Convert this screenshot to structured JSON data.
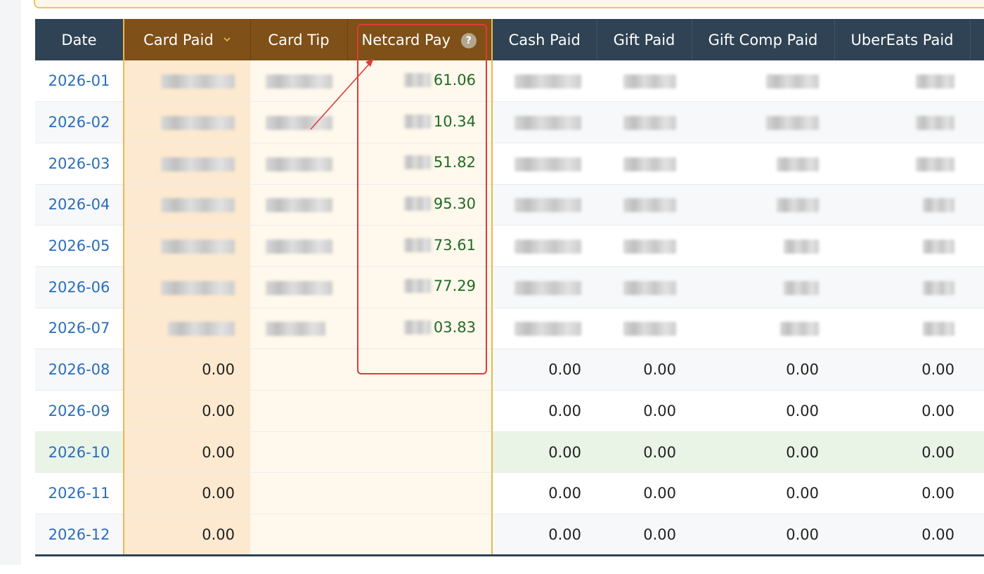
{
  "table": {
    "columns": {
      "date": "Date",
      "card_paid": "Card Paid",
      "card_tip": "Card Tip",
      "netcard_pay": "Netcard Pay",
      "cash_paid": "Cash Paid",
      "gift_paid": "Gift Paid",
      "gift_comp_paid": "Gift Comp Paid",
      "ubereats_paid": "UberEats Paid"
    },
    "help_glyph": "?",
    "rows": [
      {
        "date": "2026-01",
        "netcard_pay": "61.06",
        "redacted": true
      },
      {
        "date": "2026-02",
        "netcard_pay": "10.34",
        "redacted": true
      },
      {
        "date": "2026-03",
        "netcard_pay": "51.82",
        "redacted": true
      },
      {
        "date": "2026-04",
        "netcard_pay": "95.30",
        "redacted": true
      },
      {
        "date": "2026-05",
        "netcard_pay": "73.61",
        "redacted": true
      },
      {
        "date": "2026-06",
        "netcard_pay": "77.29",
        "redacted": true
      },
      {
        "date": "2026-07",
        "netcard_pay": "03.83",
        "redacted": true
      },
      {
        "date": "2026-08",
        "card_paid": "0.00",
        "card_tip": "",
        "netcard_pay": "",
        "cash_paid": "0.00",
        "gift_paid": "0.00",
        "gift_comp_paid": "0.00",
        "ubereats_paid": "0.00"
      },
      {
        "date": "2026-09",
        "card_paid": "0.00",
        "card_tip": "",
        "netcard_pay": "",
        "cash_paid": "0.00",
        "gift_paid": "0.00",
        "gift_comp_paid": "0.00",
        "ubereats_paid": "0.00"
      },
      {
        "date": "2026-10",
        "card_paid": "0.00",
        "card_tip": "",
        "netcard_pay": "",
        "cash_paid": "0.00",
        "gift_paid": "0.00",
        "gift_comp_paid": "0.00",
        "ubereats_paid": "0.00",
        "current": true
      },
      {
        "date": "2026-11",
        "card_paid": "0.00",
        "card_tip": "",
        "netcard_pay": "",
        "cash_paid": "0.00",
        "gift_paid": "0.00",
        "gift_comp_paid": "0.00",
        "ubereats_paid": "0.00"
      },
      {
        "date": "2026-12",
        "card_paid": "0.00",
        "card_tip": "",
        "netcard_pay": "",
        "cash_paid": "0.00",
        "gift_paid": "0.00",
        "gift_comp_paid": "0.00",
        "ubereats_paid": "0.00"
      }
    ]
  },
  "icons": {
    "sort": "chevron-down-icon",
    "help": "question-circle-icon"
  },
  "colors": {
    "header_bg": "#2f4354",
    "highlight_header_bg": "#7f5017",
    "highlight_border": "#e8b94e",
    "card_col_bg": "#fde9cf",
    "highlight_col_bg": "#fff8ec",
    "date_link": "#2a6ebb",
    "netcard_value": "#1f6b24",
    "current_row_bg": "#e9f3e6",
    "annotation_red": "#e03a3a"
  }
}
